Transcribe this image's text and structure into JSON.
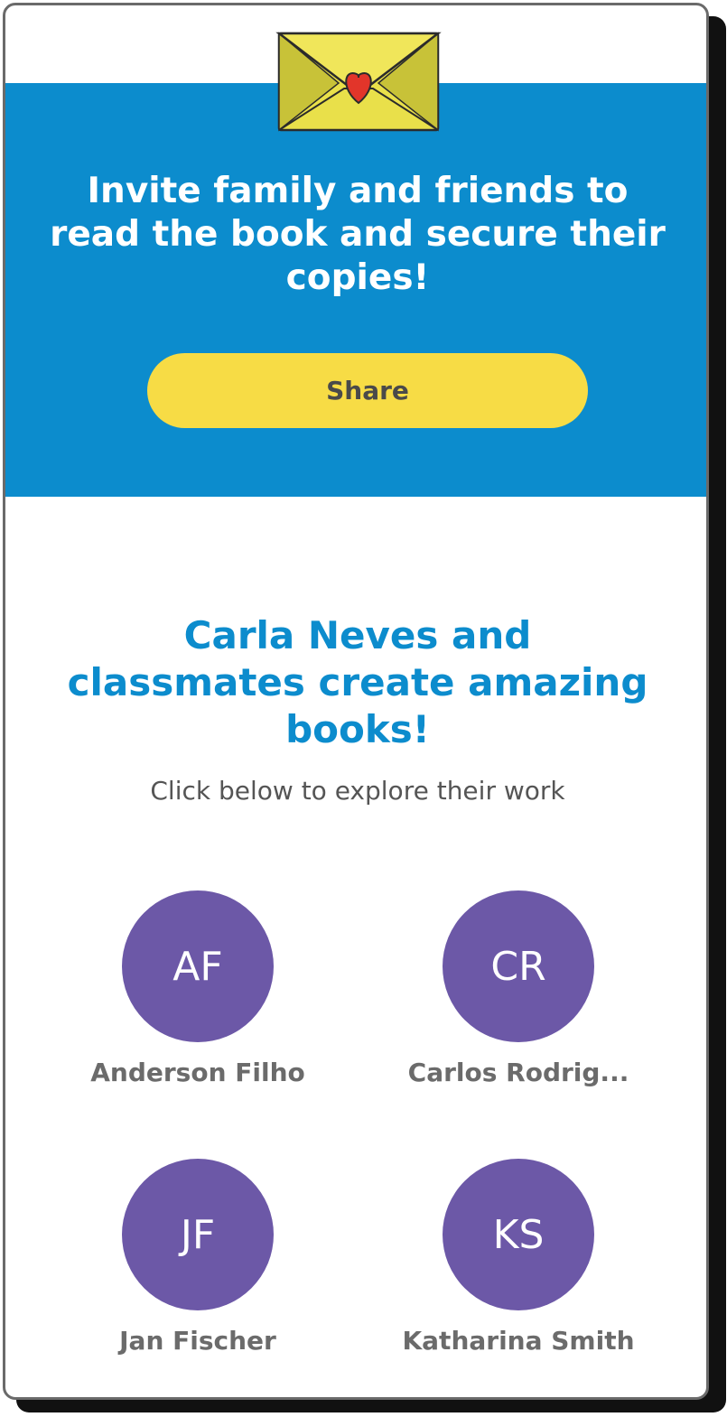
{
  "invite": {
    "title": "Invite family and friends to read the book and secure their copies!",
    "share_label": "Share",
    "band_color": "#0c8ccd",
    "button_color": "#f7dc45",
    "illustration": "envelope-with-heart-icon"
  },
  "classmates": {
    "title": "Carla Neves and classmates create amazing books!",
    "subtitle": "Click below to explore their work",
    "avatar_color": "#6c58a7",
    "students": [
      {
        "initials": "AF",
        "name": "Anderson Filho"
      },
      {
        "initials": "CR",
        "name": "Carlos Rodrig..."
      },
      {
        "initials": "JF",
        "name": "Jan Fischer"
      },
      {
        "initials": "KS",
        "name": "Katharina Smith"
      }
    ]
  }
}
